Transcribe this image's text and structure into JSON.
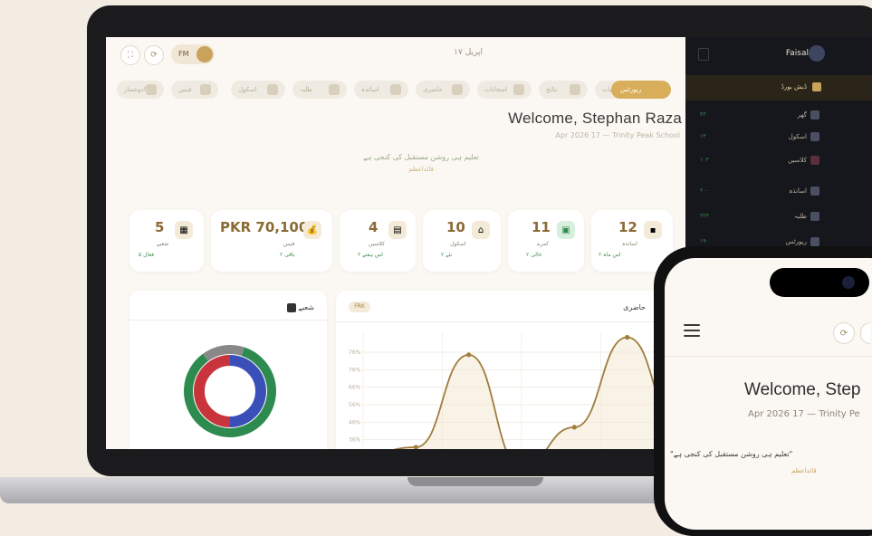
{
  "topbar": {
    "fm_label": "FM",
    "date": "۱۷ اپریل"
  },
  "sidebar": {
    "user": "Faisal",
    "items": [
      {
        "label": "ڈیش بورڈ",
        "num": ""
      },
      {
        "label": "گھر",
        "num": "۴۳"
      },
      {
        "label": "اسکول",
        "num": "۱۳"
      },
      {
        "label": "کلاسیں",
        "num": "۱۰۳"
      },
      {
        "label": "اساتذہ",
        "num": "۲۰۰"
      },
      {
        "label": "طلبہ",
        "num": "۲۲۳"
      },
      {
        "label": "رپورٹس",
        "num": "۱۹۰"
      }
    ]
  },
  "chips": [
    "اعدادوشمار",
    "فیس",
    "اسکول",
    "طلبہ",
    "اساتذہ",
    "حاضری",
    "امتحانات",
    "نتائج",
    "مالیات",
    "رپورٹس"
  ],
  "welcome": {
    "title": "Welcome, Stephan Raza",
    "subline": "Apr 2026 17 — Trinity Peak School",
    "quote": "تعلیم ہی روشن مستقبل کی کنجی ہے",
    "quote_source": "قائداعظم"
  },
  "stats": [
    {
      "value": "5",
      "label": "شعبے",
      "sub": "۵ فعال"
    },
    {
      "value": "PKR 70,100",
      "label": "فیس",
      "sub": "۲ باقی"
    },
    {
      "value": "4",
      "label": "کلاسیں",
      "sub": "۲ اس ہفتے"
    },
    {
      "value": "10",
      "label": "اسکول",
      "sub": "۲ نئے"
    },
    {
      "value": "11",
      "label": "کمرے",
      "sub": "۲ خالی"
    },
    {
      "value": "12",
      "label": "اساتذہ",
      "sub": "۲ اس ماہ"
    }
  ],
  "donut_panel": {
    "title": "شعبے"
  },
  "line_panel": {
    "title": "حاضری",
    "pill": "FRK"
  },
  "chart_data": [
    {
      "type": "pie",
      "title": "",
      "values": [
        38,
        34,
        25,
        3
      ],
      "colors": [
        "#3a4fb8",
        "#c8343c",
        "#2e8b4f",
        "#888888"
      ]
    },
    {
      "type": "line",
      "title": "",
      "x": [
        1,
        2,
        3,
        4,
        5,
        6,
        7
      ],
      "values": [
        31,
        34,
        71,
        26,
        42,
        78,
        41
      ],
      "ylim": [
        30,
        80
      ],
      "yticks": [
        "30%",
        "36%",
        "46%",
        "56%",
        "66%",
        "76%",
        "76%"
      ],
      "color": "#a07c3e"
    }
  ],
  "phone": {
    "welcome": "Welcome, Step",
    "subline": "Apr 2026 17 — Trinity Pe",
    "quote": "\"تعلیم ہی روشن مستقبل کی کنجی ہے\"",
    "quote_source": "قائداعظم"
  }
}
